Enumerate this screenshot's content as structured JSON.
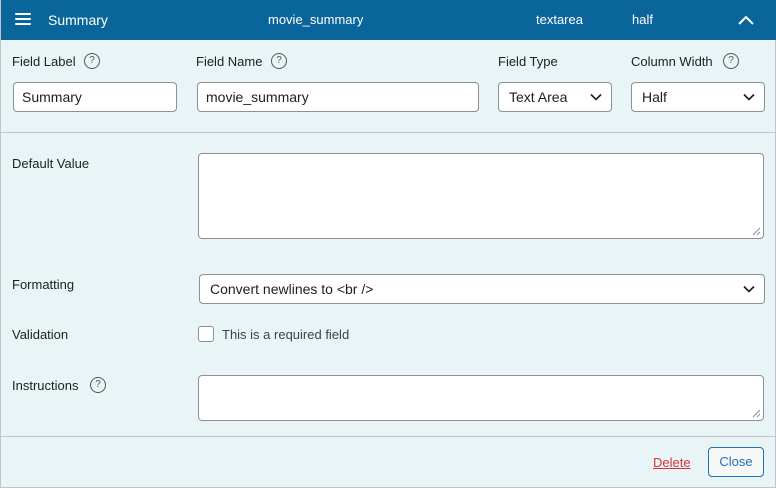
{
  "header": {
    "label": "Summary",
    "name": "movie_summary",
    "type": "textarea",
    "width": "half",
    "bg_color": "#0a659b"
  },
  "fields": {
    "field_label": {
      "label": "Field Label",
      "value": "Summary"
    },
    "field_name": {
      "label": "Field Name",
      "value": "movie_summary"
    },
    "field_type": {
      "label": "Field Type",
      "value": "Text Area"
    },
    "column_width": {
      "label": "Column Width",
      "value": "Half"
    },
    "help_glyph": "?"
  },
  "default_value": {
    "label": "Default Value",
    "value": ""
  },
  "formatting": {
    "label": "Formatting",
    "value": "Convert newlines to <br />"
  },
  "validation": {
    "label": "Validation",
    "checkbox_label": "This is a required field",
    "checked": false
  },
  "instructions": {
    "label": "Instructions",
    "value": ""
  },
  "footer": {
    "delete_label": "Delete",
    "close_label": "Close",
    "delete_color": "#d63638",
    "accent_color": "#2271b1"
  }
}
